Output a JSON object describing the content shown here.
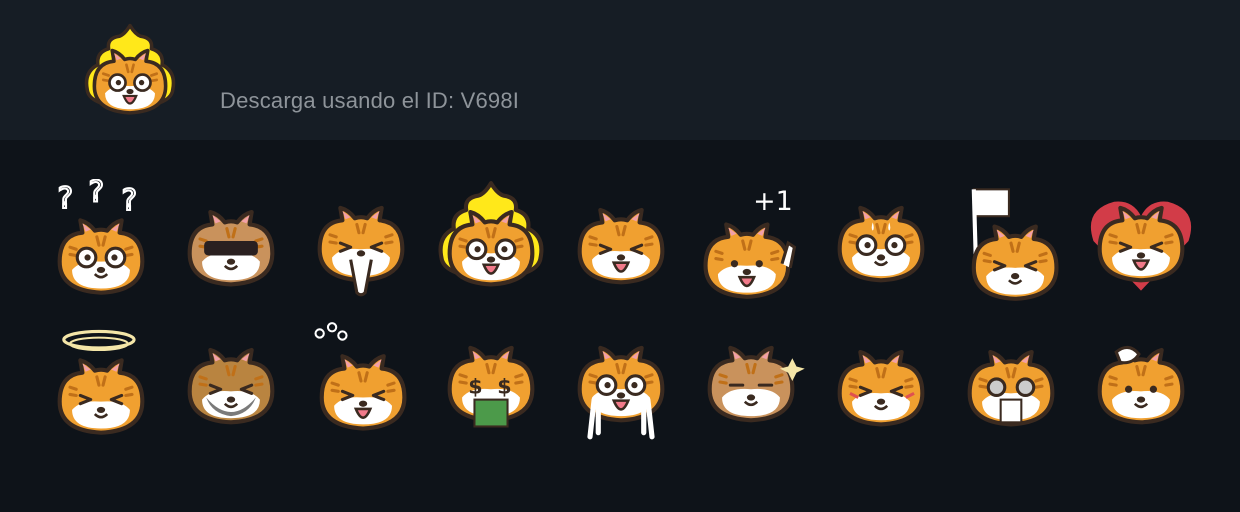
{
  "header": {
    "download_text": "Descarga usando el ID: V698I",
    "icon": "poop-cat-sticker-icon"
  },
  "colors": {
    "header_bg": "#161d25",
    "page_bg": "#0e1319",
    "text": "#8e949a",
    "cat_orange": "#f0a030",
    "cat_outline": "#3a2a20",
    "poop_yellow": "#ffe81a"
  },
  "stickers": [
    {
      "icon": "confused-cat-icon",
      "variant": "question"
    },
    {
      "icon": "sunglasses-cat-icon",
      "variant": "glasses"
    },
    {
      "icon": "praying-cat-icon",
      "variant": "pray"
    },
    {
      "icon": "poop-cat-icon",
      "variant": "poop"
    },
    {
      "icon": "tongue-out-cat-icon",
      "variant": "tongue"
    },
    {
      "icon": "plus-one-cat-icon",
      "variant": "plusone"
    },
    {
      "icon": "sweating-cat-icon",
      "variant": "sweat"
    },
    {
      "icon": "white-flag-cat-icon",
      "variant": "flag"
    },
    {
      "icon": "heart-cat-icon",
      "variant": "heart"
    },
    {
      "icon": "dizzy-cat-icon",
      "variant": "dizzy"
    },
    {
      "icon": "bearded-cat-icon",
      "variant": "beard"
    },
    {
      "icon": "laughing-cat-icon",
      "variant": "laugh"
    },
    {
      "icon": "money-cat-icon",
      "variant": "money"
    },
    {
      "icon": "crying-cat-icon",
      "variant": "cry"
    },
    {
      "icon": "smug-cat-icon",
      "variant": "smug"
    },
    {
      "icon": "blushing-cat-icon",
      "variant": "blush"
    },
    {
      "icon": "shocked-cat-icon",
      "variant": "shock"
    },
    {
      "icon": "thinking-cat-icon",
      "variant": "think"
    }
  ]
}
